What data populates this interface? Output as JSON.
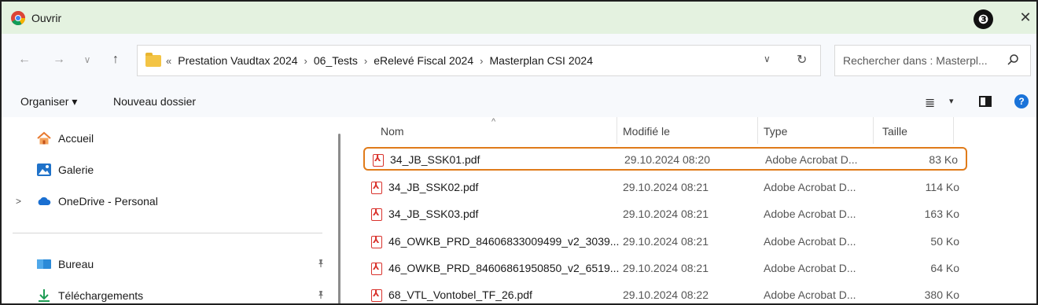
{
  "window": {
    "title": "Ouvrir",
    "step_badge": "❸",
    "close_glyph": "✕"
  },
  "nav": {
    "back": "←",
    "forward": "→",
    "recent": "∨",
    "up": "↑",
    "overflow": "«",
    "breadcrumbs": [
      "Prestation Vaudtax 2024",
      "06_Tests",
      "eRelevé Fiscal 2024",
      "Masterplan CSI 2024"
    ],
    "dropdown": "∨",
    "refresh": "↻",
    "search_placeholder": "Rechercher dans : Masterpl..."
  },
  "commands": {
    "organiser": "Organiser ▾",
    "new_folder": "Nouveau dossier",
    "view": "≣",
    "view_dropdown": "▾",
    "help": "?"
  },
  "sidebar": {
    "items": [
      {
        "label": "Accueil",
        "icon": "home-icon"
      },
      {
        "label": "Galerie",
        "icon": "gallery-icon"
      },
      {
        "label": "OneDrive - Personal",
        "icon": "cloud-icon"
      },
      {
        "label": "Bureau",
        "icon": "desktop-icon"
      },
      {
        "label": "Téléchargements",
        "icon": "download-icon"
      }
    ],
    "expander": ">",
    "pin": "📌"
  },
  "filelist": {
    "columns": {
      "name": "Nom",
      "modified": "Modifié le",
      "type": "Type",
      "size": "Taille"
    },
    "sort_caret": "^",
    "rows": [
      {
        "name": "34_JB_SSK01.pdf",
        "modified": "29.10.2024 08:20",
        "type": "Adobe Acrobat D...",
        "size": "83 Ko",
        "selected": true
      },
      {
        "name": "34_JB_SSK02.pdf",
        "modified": "29.10.2024 08:21",
        "type": "Adobe Acrobat D...",
        "size": "114 Ko"
      },
      {
        "name": "34_JB_SSK03.pdf",
        "modified": "29.10.2024 08:21",
        "type": "Adobe Acrobat D...",
        "size": "163 Ko"
      },
      {
        "name": "46_OWKB_PRD_84606833009499_v2_3039...",
        "modified": "29.10.2024 08:21",
        "type": "Adobe Acrobat D...",
        "size": "50 Ko"
      },
      {
        "name": "46_OWKB_PRD_84606861950850_v2_6519...",
        "modified": "29.10.2024 08:21",
        "type": "Adobe Acrobat D...",
        "size": "64 Ko"
      },
      {
        "name": "68_VTL_Vontobel_TF_26.pdf",
        "modified": "29.10.2024 08:22",
        "type": "Adobe Acrobat D...",
        "size": "380 Ko"
      }
    ]
  },
  "colors": {
    "titlebar_bg": "#e4f2e0",
    "selection_border": "#e07b1a",
    "pdf_red": "#d9322c",
    "accent_blue": "#1a73d9"
  }
}
